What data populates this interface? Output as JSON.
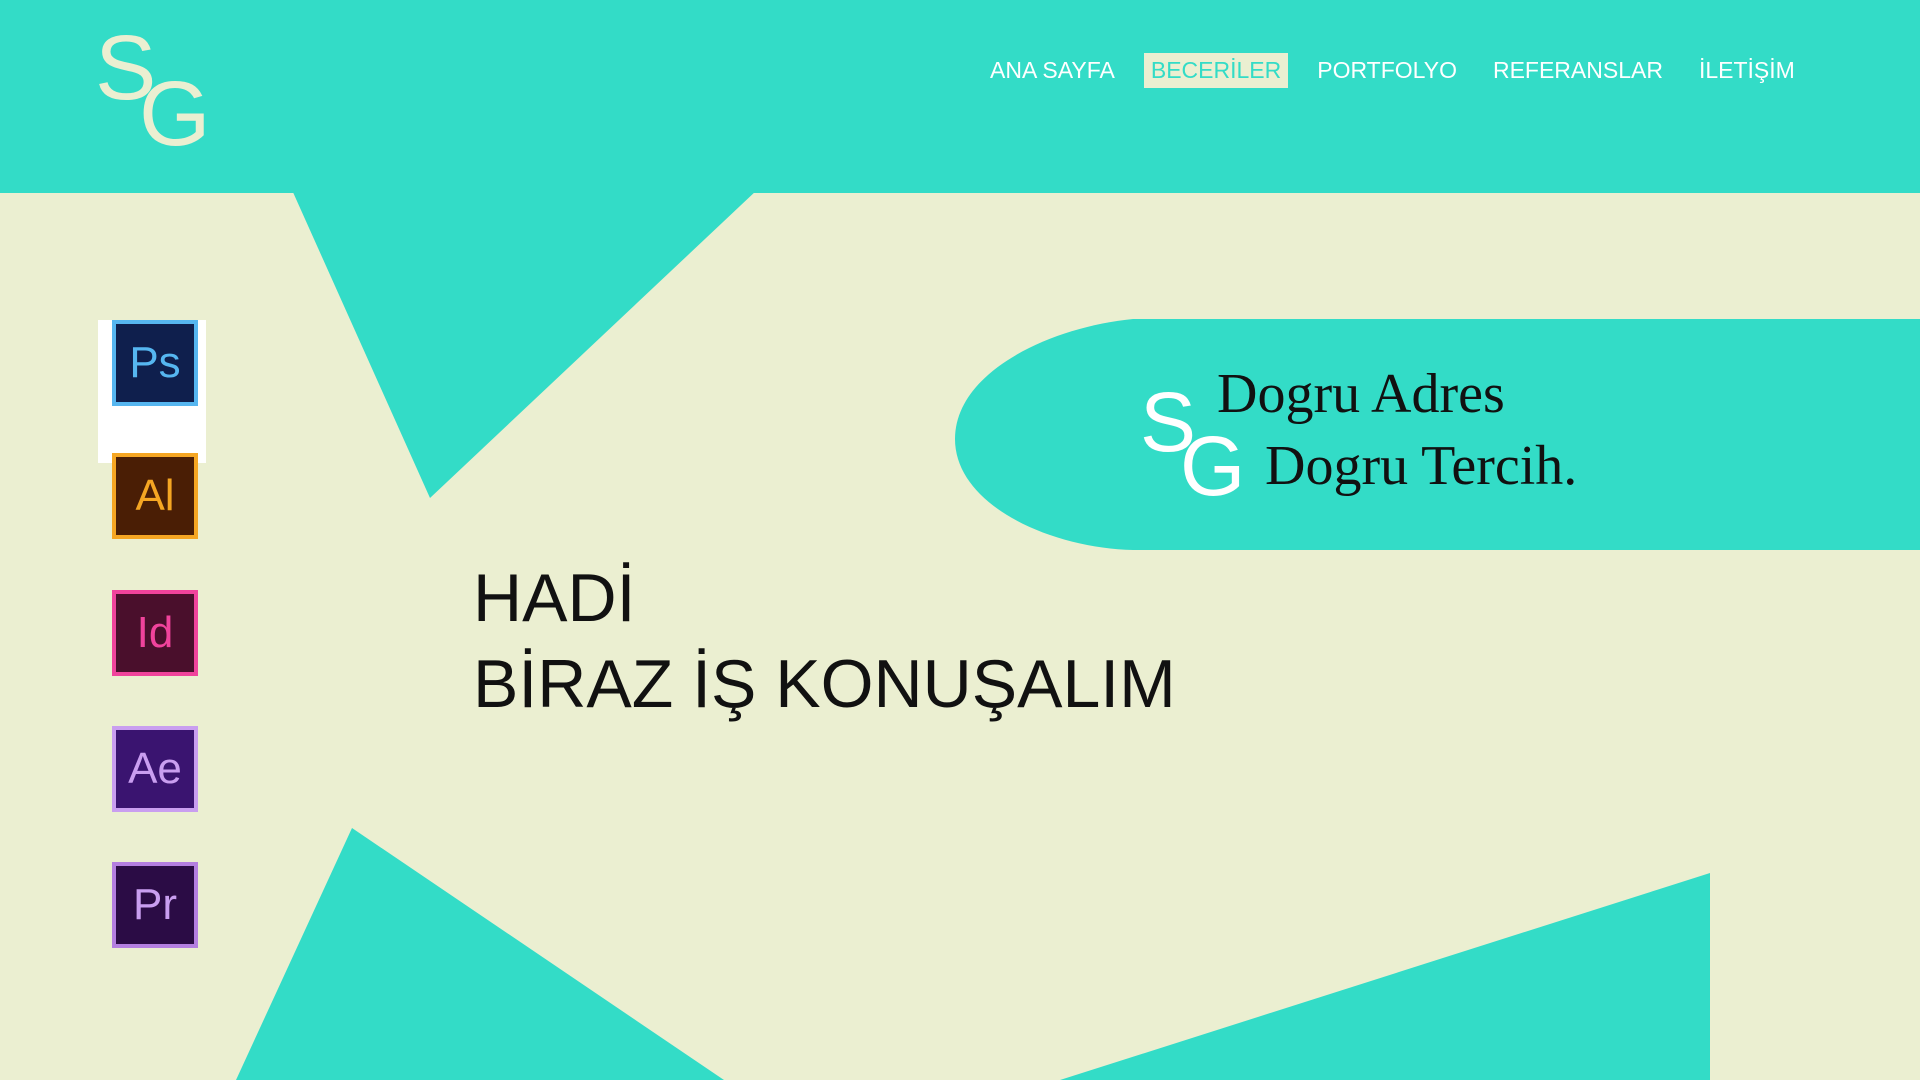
{
  "colors": {
    "accent": "#33dcc7",
    "background": "#ebefd1",
    "text": "#111111",
    "nav_text": "#ffffff"
  },
  "header": {
    "logo": {
      "s": "S",
      "g": "G"
    },
    "nav": [
      {
        "label": "ANA SAYFA",
        "active": false
      },
      {
        "label": "BECERİLER",
        "active": true
      },
      {
        "label": "PORTFOLYO",
        "active": false
      },
      {
        "label": "REFERANSLAR",
        "active": false
      },
      {
        "label": "İLETİŞİM",
        "active": false
      }
    ]
  },
  "skills": [
    {
      "label": "Ps",
      "icon": "photoshop-icon",
      "fill": "#0f1f4d",
      "border": "#56b6f0",
      "text": "#56b6f0"
    },
    {
      "label": "Al",
      "icon": "illustrator-icon",
      "fill": "#4a1e05",
      "border": "#f5a623",
      "text": "#f5a623"
    },
    {
      "label": "Id",
      "icon": "indesign-icon",
      "fill": "#4a0f2c",
      "border": "#f0439c",
      "text": "#f0439c"
    },
    {
      "label": "Ae",
      "icon": "after-effects-icon",
      "fill": "#3a1470",
      "border": "#c99ef0",
      "text": "#c99ef0"
    },
    {
      "label": "Pr",
      "icon": "premiere-icon",
      "fill": "#2b0c45",
      "border": "#b47fe0",
      "text": "#c99ef0"
    }
  ],
  "slogan": {
    "logo": {
      "s": "S",
      "g": "G"
    },
    "line1": "Dogru Adres",
    "line2": "Dogru Tercih."
  },
  "headline": {
    "line1": "HADİ",
    "line2": "BİRAZ İŞ KONUŞALIM"
  }
}
